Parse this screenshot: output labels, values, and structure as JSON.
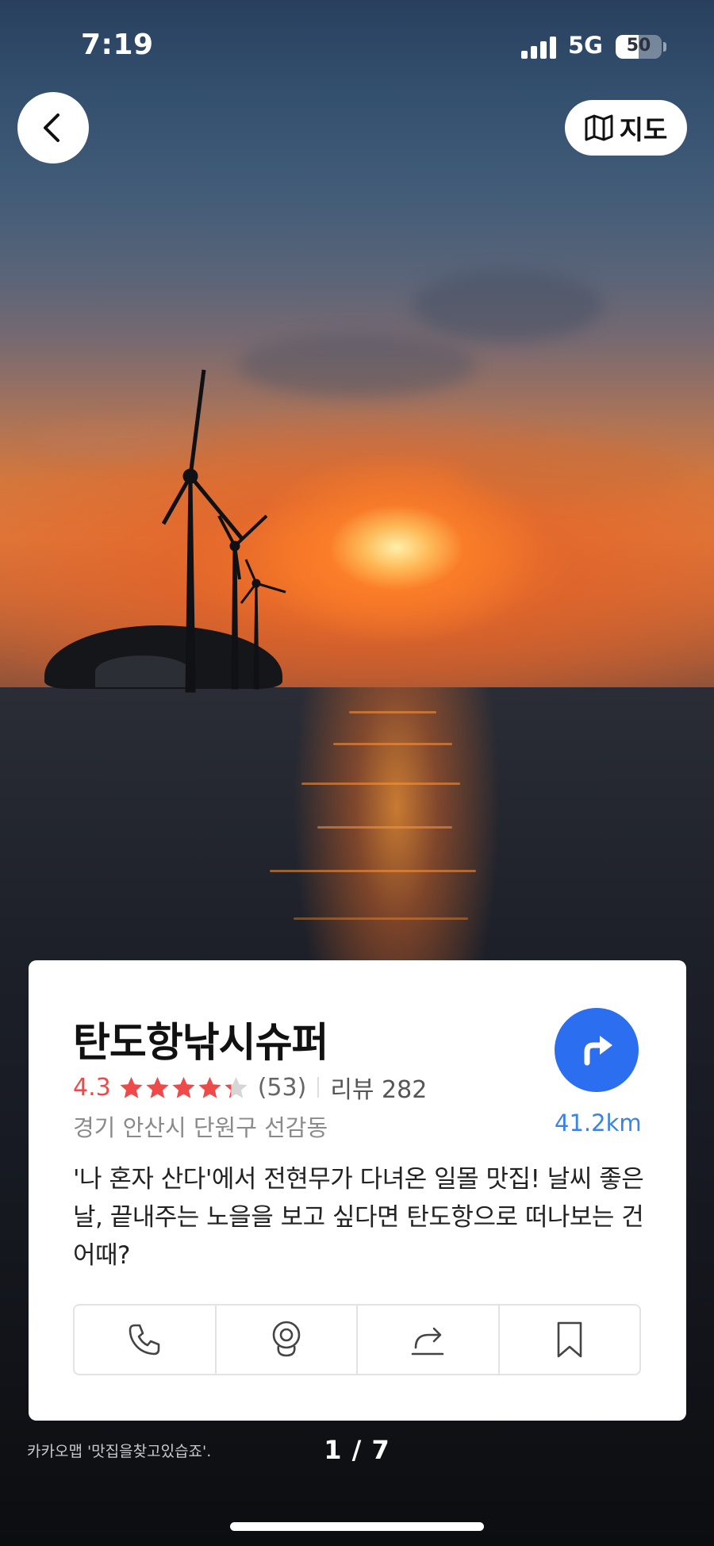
{
  "status_bar": {
    "time": "7:19",
    "network": "5G",
    "battery": "50",
    "battery_level": 0.5
  },
  "top_bar": {
    "map_label": "지도",
    "back_icon": "chevron-left-icon",
    "map_icon": "map-icon"
  },
  "place": {
    "name": "탄도항낚시슈퍼",
    "rating": "4.3",
    "rating_value": 4.3,
    "rating_count": "(53)",
    "review": "리뷰 282",
    "address": "경기 안산시 단원구 선감동",
    "distance": "41.2km",
    "description": "'나 혼자 산다'에서 전현무가 다녀온 일몰 맛집! 날씨 좋은 날, 끝내주는 노을을 보고 싶다면 탄도항으로 떠나보는 건 어때?"
  },
  "actions": [
    "phone-icon",
    "webcam-icon",
    "share-icon",
    "bookmark-icon"
  ],
  "footer": {
    "credit": "카카오맵 '맛집을찾고있습죠'.",
    "pager": "1 / 7"
  },
  "colors": {
    "accent": "#2b6ff0",
    "rating": "#ee4a4a",
    "distance": "#3b82e6"
  }
}
